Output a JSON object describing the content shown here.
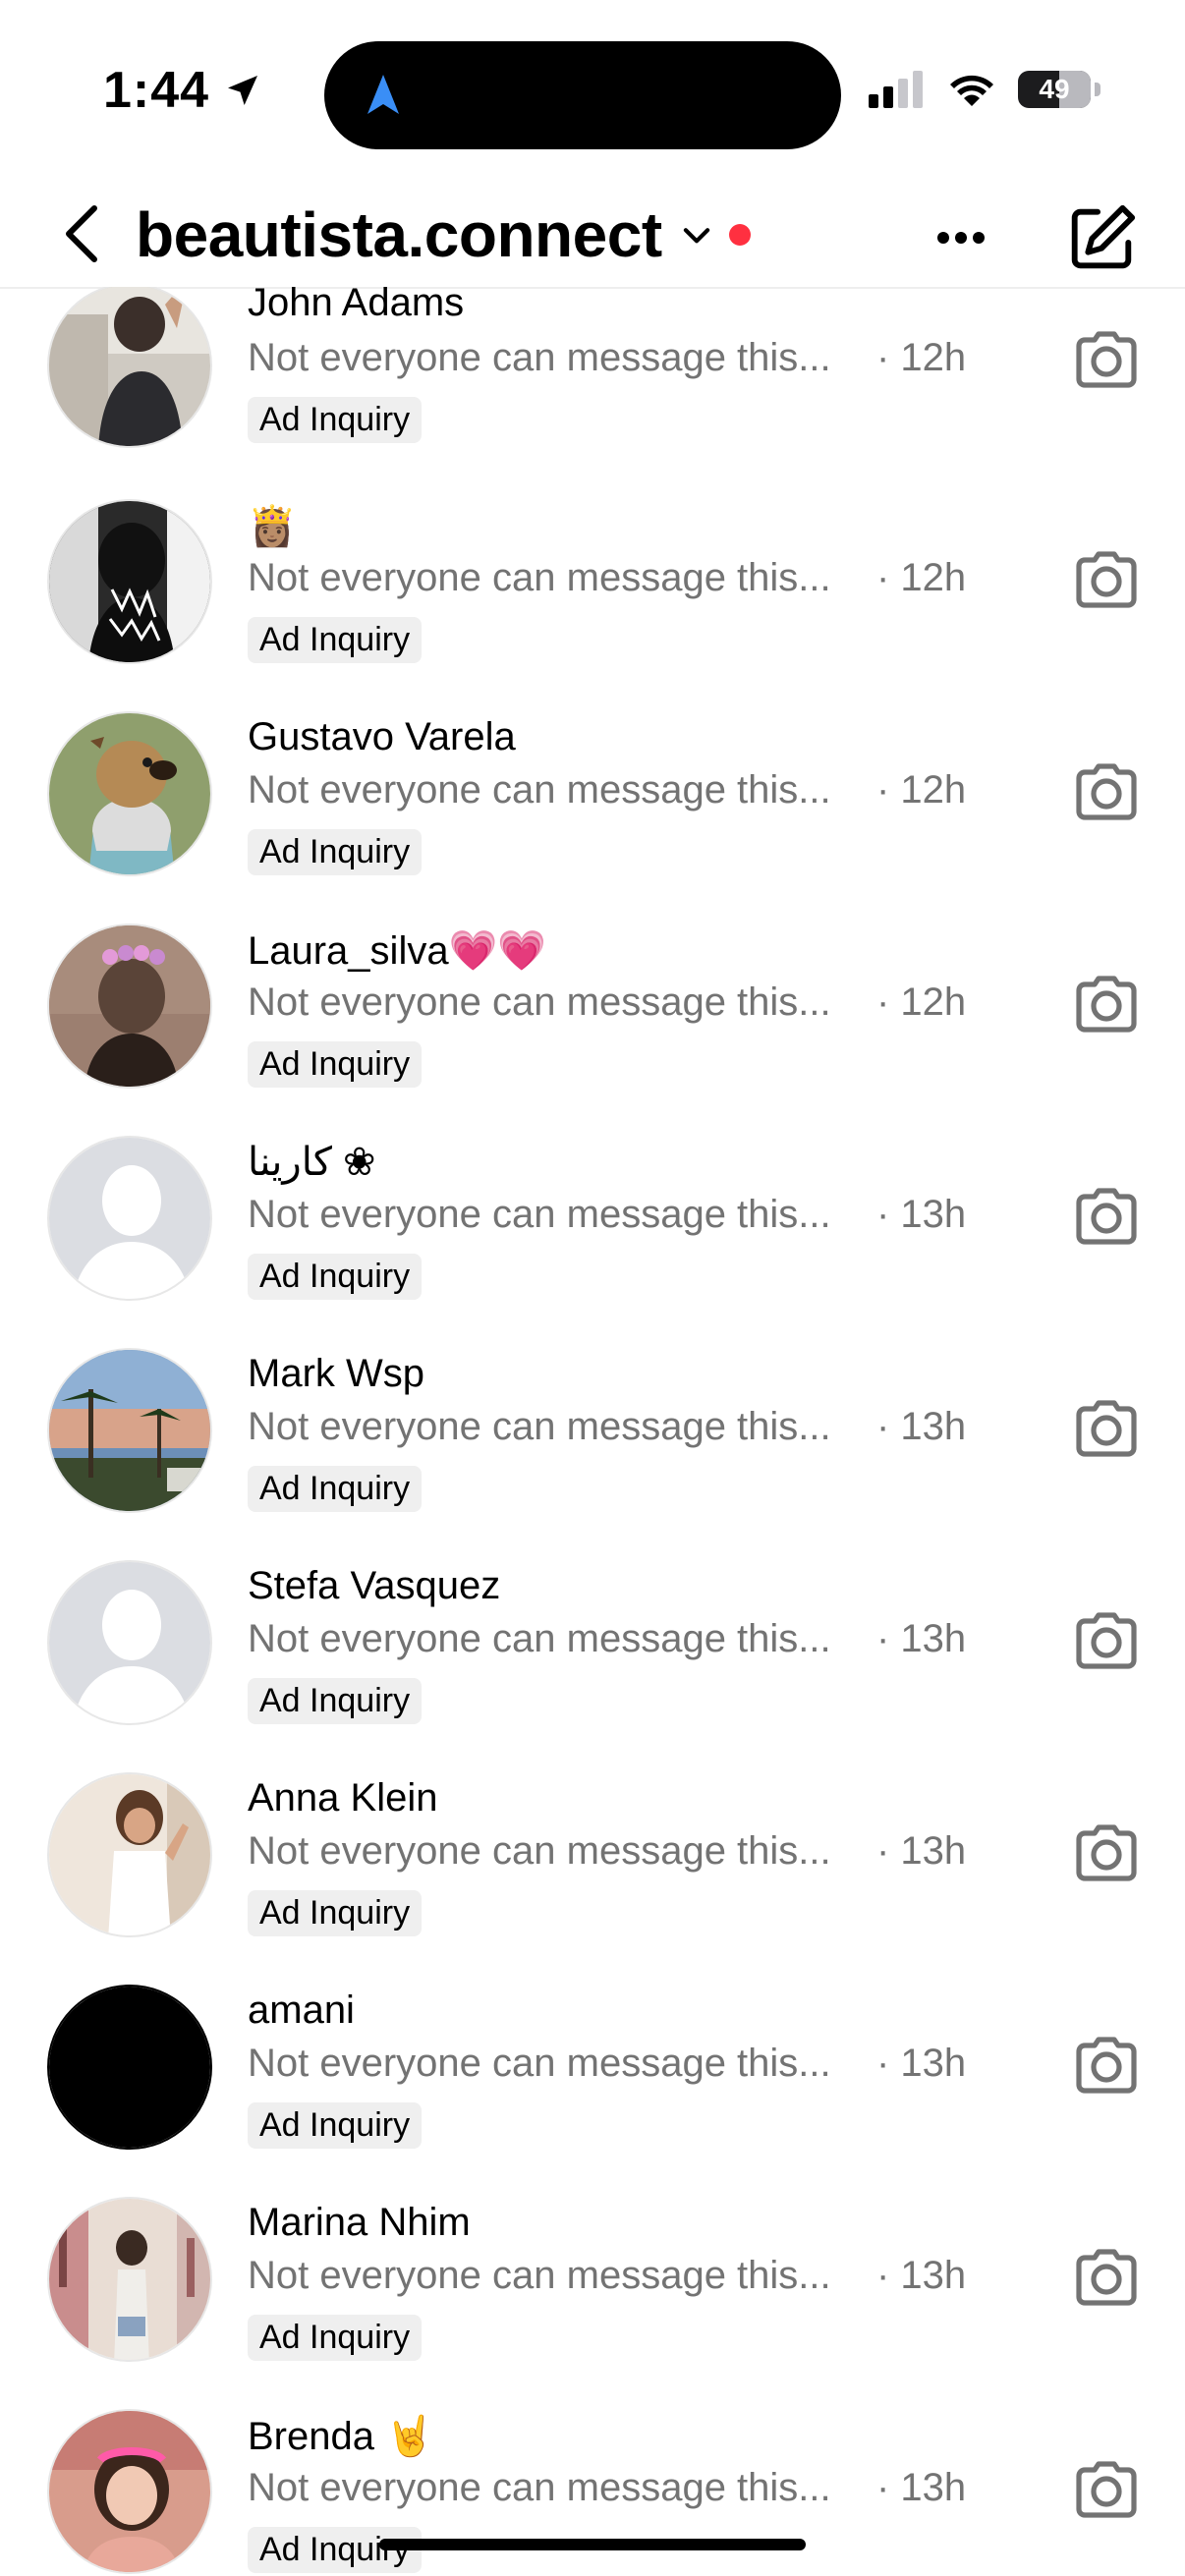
{
  "status_bar": {
    "time": "1:44",
    "battery": "49"
  },
  "header": {
    "title": "beautista.connect"
  },
  "colors": {
    "accent_red": "#ff3040",
    "secondary_text": "#737373",
    "tag_bg": "#efefef"
  },
  "threads": [
    {
      "name": "John Adams",
      "preview": "Not everyone can message this...",
      "time": "· 12h",
      "tag": "Ad Inquiry",
      "avatar": "photo"
    },
    {
      "name": "👸🏽",
      "preview": "Not everyone can message this...",
      "time": "· 12h",
      "tag": "Ad Inquiry",
      "avatar": "photo"
    },
    {
      "name": "Gustavo Varela",
      "preview": "Not everyone can message this...",
      "time": "· 12h",
      "tag": "Ad Inquiry",
      "avatar": "cartoon"
    },
    {
      "name": "Laura_silva💗💗",
      "preview": "Not everyone can message this...",
      "time": "· 12h",
      "tag": "Ad Inquiry",
      "avatar": "photo"
    },
    {
      "name": "كارينا ❀",
      "preview": "Not everyone can message this...",
      "time": "· 13h",
      "tag": "Ad Inquiry",
      "avatar": "default"
    },
    {
      "name": "Mark Wsp",
      "preview": "Not everyone can message this...",
      "time": "· 13h",
      "tag": "Ad Inquiry",
      "avatar": "photo"
    },
    {
      "name": "Stefa Vasquez",
      "preview": "Not everyone can message this...",
      "time": "· 13h",
      "tag": "Ad Inquiry",
      "avatar": "default"
    },
    {
      "name": "Anna Klein",
      "preview": "Not everyone can message this...",
      "time": "· 13h",
      "tag": "Ad Inquiry",
      "avatar": "photo"
    },
    {
      "name": "amani",
      "preview": "Not everyone can message this...",
      "time": "· 13h",
      "tag": "Ad Inquiry",
      "avatar": "black"
    },
    {
      "name": "Marina Nhim",
      "preview": "Not everyone can message this...",
      "time": "· 13h",
      "tag": "Ad Inquiry",
      "avatar": "photo"
    },
    {
      "name": "Brenda 🤘",
      "preview": "Not everyone can message this...",
      "time": "· 13h",
      "tag": "Ad Inquiry",
      "avatar": "photo"
    }
  ]
}
